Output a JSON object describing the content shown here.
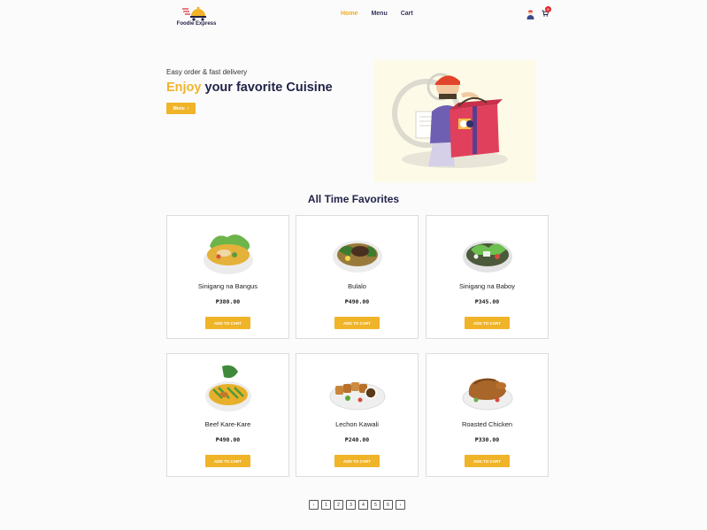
{
  "brand": {
    "name": "Foodie Express"
  },
  "nav": {
    "items": [
      {
        "label": "Home",
        "active": true
      },
      {
        "label": "Menu",
        "active": false
      },
      {
        "label": "Cart",
        "active": false
      }
    ]
  },
  "cart": {
    "count": "0"
  },
  "hero": {
    "subtitle": "Easy order & fast delivery",
    "title_accent": "Enjoy",
    "title_rest": " your favorite Cuisine",
    "button_label": "Menu",
    "button_arrow": "›"
  },
  "section": {
    "title": "All Time Favorites"
  },
  "products": [
    {
      "name": "Sinigang na Bangus",
      "price": "₱380.00",
      "button": "ADD TO CART",
      "dish": "soup-green"
    },
    {
      "name": "Bulalo",
      "price": "₱490.00",
      "button": "ADD TO CART",
      "dish": "beef-soup"
    },
    {
      "name": "Sinigang na Baboy",
      "price": "₱345.00",
      "button": "ADD TO CART",
      "dish": "soup-clear"
    },
    {
      "name": "Beef Kare-Kare",
      "price": "₱490.00",
      "button": "ADD TO CART",
      "dish": "kare-kare"
    },
    {
      "name": "Lechon Kawali",
      "price": "₱240.00",
      "button": "ADD TO CART",
      "dish": "lechon"
    },
    {
      "name": "Roasted Chicken",
      "price": "₱330.00",
      "button": "ADD TO CART",
      "dish": "chicken"
    }
  ],
  "pagination": {
    "prev": "‹",
    "pages": [
      "1",
      "2",
      "3",
      "4",
      "5",
      "6"
    ],
    "next": "›"
  },
  "colors": {
    "accent": "#f0b429",
    "navy": "#23234a",
    "badge": "#e0282d"
  }
}
